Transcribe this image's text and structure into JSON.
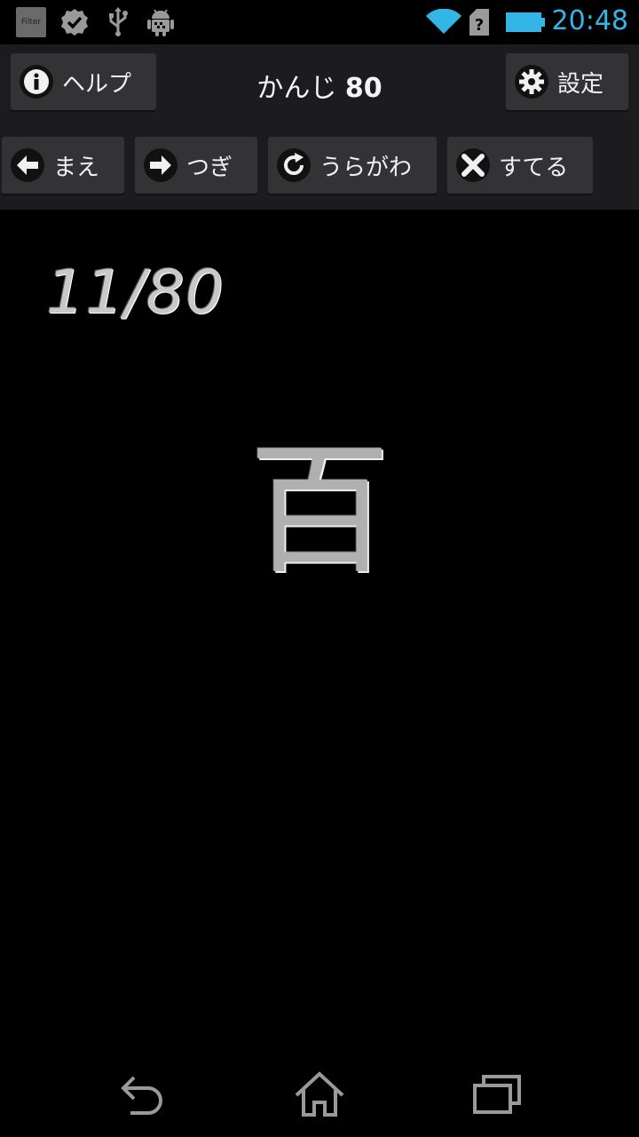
{
  "status_bar": {
    "filter_label": "Filter",
    "time": "20:48",
    "icons": [
      "filter-icon",
      "check-badge-icon",
      "usb-icon",
      "android-debug-icon",
      "wifi-icon",
      "sim-unknown-icon",
      "battery-icon"
    ],
    "accent_color": "#33b5e5"
  },
  "header": {
    "help_label": "ヘルプ",
    "title_text": "かんじ",
    "title_number": "80",
    "settings_label": "設定"
  },
  "toolbar": {
    "prev_label": "まえ",
    "next_label": "つぎ",
    "flip_label": "うらがわ",
    "discard_label": "すてる"
  },
  "card": {
    "counter": "11/80",
    "kanji": "百"
  },
  "nav_bar": {
    "icons": [
      "back-icon",
      "home-icon",
      "recent-apps-icon"
    ]
  }
}
